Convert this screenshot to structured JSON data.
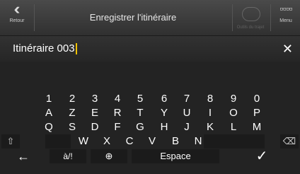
{
  "header": {
    "back_label": "Retour",
    "back_icon": "double-chevron-left-icon",
    "title": "Enregistrer l'itinéraire",
    "tools_label": "Outils du trajet",
    "menu_label": "Menu"
  },
  "input": {
    "value": "Itinéraire 003",
    "clear_icon": "close-icon"
  },
  "keyboard": {
    "row1": [
      "1",
      "2",
      "3",
      "4",
      "5",
      "6",
      "7",
      "8",
      "9",
      "0"
    ],
    "row2": [
      "A",
      "Z",
      "E",
      "R",
      "T",
      "Y",
      "U",
      "I",
      "O",
      "P"
    ],
    "row3": [
      "Q",
      "S",
      "D",
      "F",
      "G",
      "H",
      "J",
      "K",
      "L",
      "M"
    ],
    "row4": [
      "W",
      "X",
      "C",
      "V",
      "B",
      "N"
    ],
    "shift_glyph": "⇧",
    "backspace_glyph": "⌫",
    "back_glyph": "←",
    "symbols_label": "à/!",
    "globe_glyph": "⊕",
    "space_label": "Espace",
    "ok_glyph": "✓"
  }
}
